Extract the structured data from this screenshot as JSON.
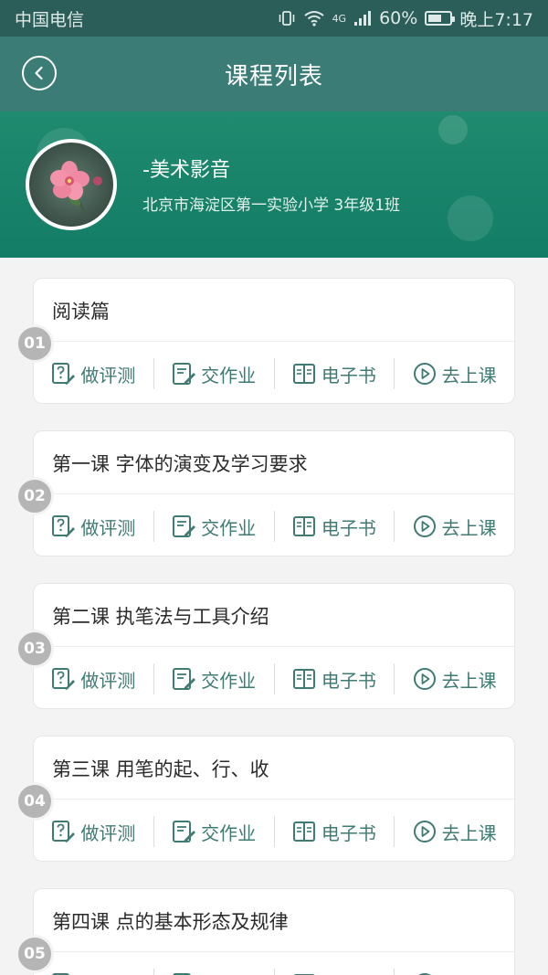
{
  "status_bar": {
    "carrier": "中国电信",
    "network": "4G",
    "battery": "60%",
    "battery_level": 0.6,
    "time": "晚上7:17"
  },
  "header": {
    "title": "课程列表",
    "back_icon": "back-arrow-icon"
  },
  "profile": {
    "course_name": "-美术影音",
    "school_class": "北京市海淀区第一实验小学 3年级1班"
  },
  "action_labels": {
    "test": "做评测",
    "homework": "交作业",
    "ebook": "电子书",
    "class": "去上课"
  },
  "lessons": [
    {
      "number": "01",
      "title": "阅读篇"
    },
    {
      "number": "02",
      "title": "第一课  字体的演变及学习要求"
    },
    {
      "number": "03",
      "title": "第二课  执笔法与工具介绍"
    },
    {
      "number": "04",
      "title": "第三课  用笔的起、行、收"
    },
    {
      "number": "05",
      "title": "第四课  点的基本形态及规律"
    }
  ],
  "colors": {
    "header_bg": "#3b7d76",
    "banner_bg": "#137d66",
    "action_text": "#3f7b73",
    "badge_bg": "#b5b5b5"
  }
}
